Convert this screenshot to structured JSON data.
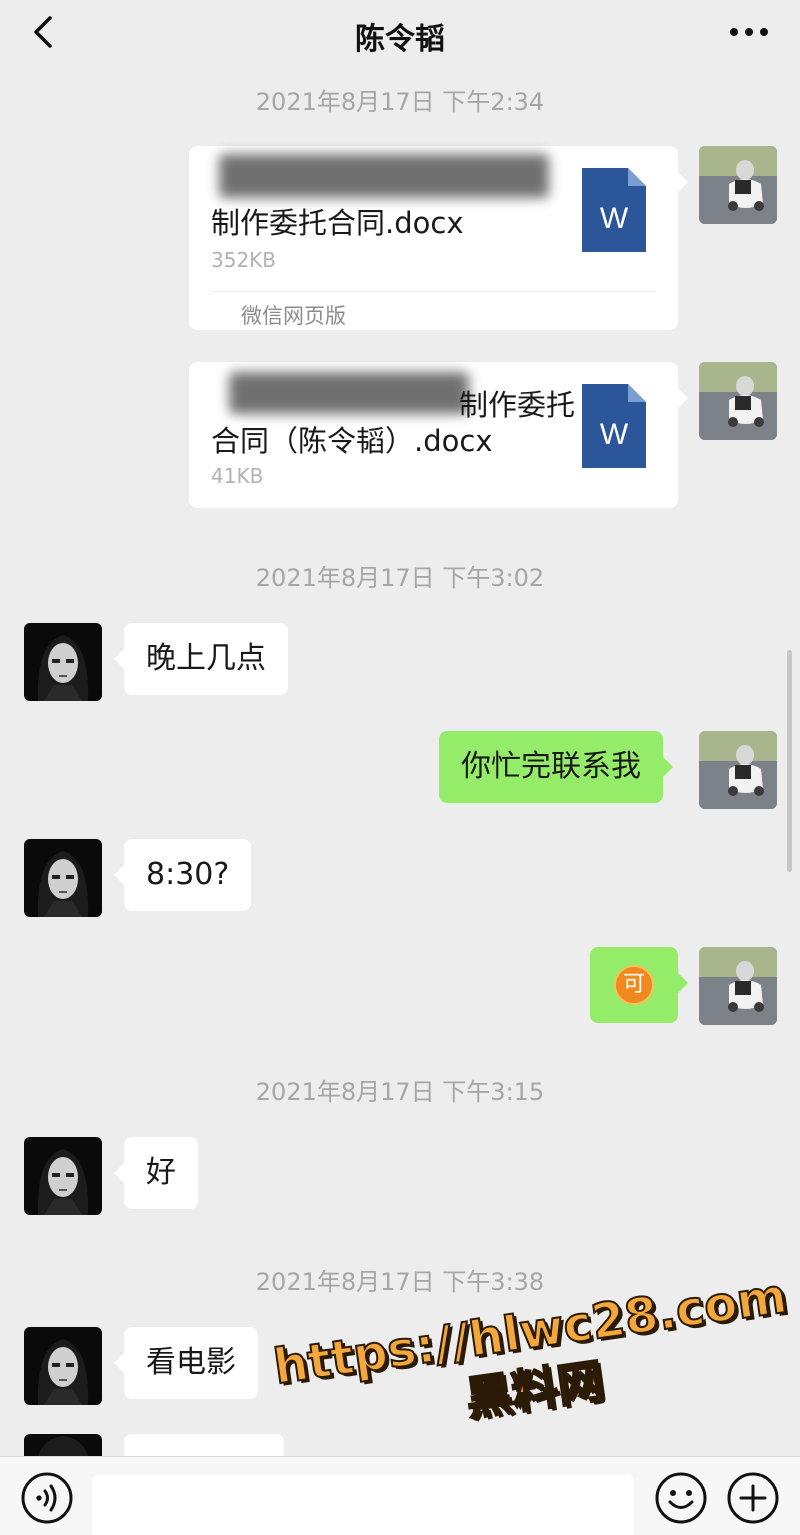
{
  "header": {
    "title": "陈令韬"
  },
  "timestamps": [
    "2021年8月17日 下午2:34",
    "2021年8月17日 下午3:02",
    "2021年8月17日 下午3:15",
    "2021年8月17日 下午3:38"
  ],
  "files": [
    {
      "name_line": "制作委托合同.docx",
      "size": "352KB",
      "source": "微信网页版",
      "icon_label": "W"
    },
    {
      "name_line1": "制作委托",
      "name_line2": "合同（陈令韬）.docx",
      "size": "41KB",
      "icon_label": "W"
    }
  ],
  "messages": [
    {
      "side": "left",
      "text": "晚上几点"
    },
    {
      "side": "right",
      "text": "你忙完联系我"
    },
    {
      "side": "left",
      "text": "8:30?"
    },
    {
      "side": "right",
      "text": "可",
      "kind": "emoji-badge"
    },
    {
      "side": "left",
      "text": "好"
    },
    {
      "side": "left",
      "text": "看电影"
    }
  ],
  "watermark": {
    "url": "https://hlwc28.com",
    "site": "黑料网"
  },
  "icons": {
    "back": "chevron-left-icon",
    "more": "more-dots-icon",
    "voice": "voice-icon",
    "emoji": "emoji-icon",
    "plus": "plus-icon",
    "word": "word-doc-icon"
  },
  "colors": {
    "background": "#ededed",
    "bubble_green": "#95ec69",
    "bubble_white": "#ffffff",
    "word_blue": "#2b579a",
    "timestamp": "#a6a6a6",
    "watermark": "#f4a73a"
  }
}
